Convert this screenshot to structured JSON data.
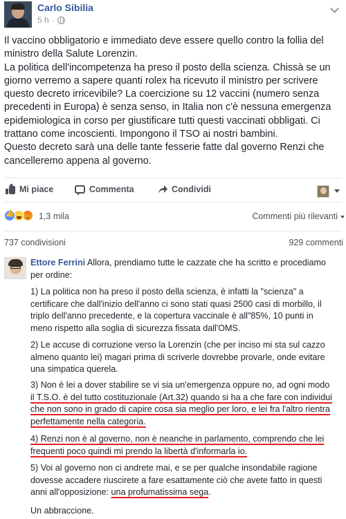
{
  "post": {
    "author": "Carlo Sibilia",
    "time": "5 h",
    "text_lines": [
      "Il vaccino obbligatorio e immediato deve essere quello contro la follia del",
      "ministro della Salute Lorenzin.",
      "La politica dell'incompetenza ha preso il posto della scienza. Chissà se un",
      "giorno verremo a sapere quanti rolex ha ricevuto il ministro per scrivere",
      "questo decreto irricevibile? La coercizione su 12 vaccini (numero senza",
      "precedenti in Europa) è senza senso, in Italia non c'è nessuna emergenza",
      "epidemiologica in corso per giustificare tutti questi vaccinati obbligati. Ci",
      "trattano come incoscienti. Impongono il TSO ai nostri bambini.",
      "Questo decreto sarà una delle tante fesserie fatte dal governo Renzi che",
      "cancelleremo appena al governo."
    ]
  },
  "actions": {
    "like": "Mi piace",
    "comment": "Commenta",
    "share": "Condividi"
  },
  "reactions": {
    "count": "1,3 mila",
    "sort_label": "Commenti più rilevanti"
  },
  "counts": {
    "shares": "737 condivisioni",
    "comments": "929 commenti"
  },
  "comment": {
    "author": "Ettore Ferrini",
    "intro_lines": [
      " Allora, prendiamo tutte le cazzate che ha scritto e procediamo",
      "per ordine:"
    ],
    "p1": [
      "1) La politica non ha preso il posto della scienza, è infatti la \"scienza\" a",
      "certificare che dall'inizio dell'anno ci sono stati quasi 2500 casi di morbillo, il",
      "triplo dell'anno precedente, e la copertura vaccinale è all\"85%, 10 punti in",
      "meno rispetto alla soglia di sicurezza fissata dall'OMS."
    ],
    "p2": [
      "2) Le accuse di corruzione verso la Lorenzin (che per inciso mi sta sul cazzo",
      "almeno quanto lei) magari prima di scriverle dovrebbe provarle, onde evitare",
      "una simpatica querela."
    ],
    "p3": [
      "3) Non è lei a dover stabilire se vi sia un'emergenza oppure no, ad ogni modo",
      "il T.S.O. è del tutto costituzionale (Art.32) quando si ha a che fare con individui",
      "che non sono in grado di capire cosa sia meglio per loro, e lei fra l'altro rientra",
      "perfettamente nella categoria."
    ],
    "p4": [
      "4) Renzi non è al governo, non è neanche in parlamento, comprendo che lei",
      "frequenti poco quindi mi prendo la libertà d'informarla io."
    ],
    "p5": [
      "5) Voi al governo non ci andrete mai, e se per qualche insondabile ragione",
      "dovesse accadere riuscirete a fare esattamente ciò che avete fatto in questi",
      "anni all'opposizione: "
    ],
    "p5_underlined": "una profumatissima sega",
    "p5_end": ".",
    "closing": "Un abbraccione."
  }
}
